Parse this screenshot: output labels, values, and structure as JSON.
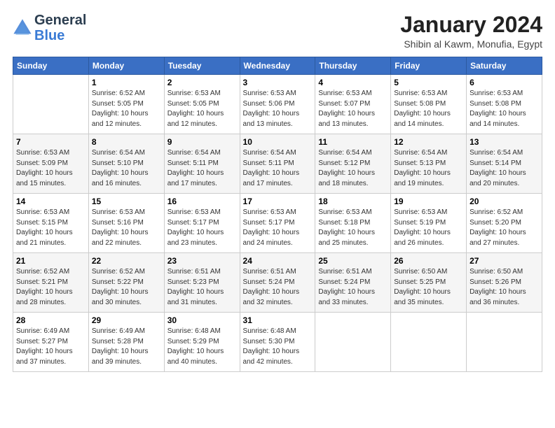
{
  "header": {
    "logo_line1": "General",
    "logo_line2": "Blue",
    "month_title": "January 2024",
    "location": "Shibin al Kawm, Monufia, Egypt"
  },
  "weekdays": [
    "Sunday",
    "Monday",
    "Tuesday",
    "Wednesday",
    "Thursday",
    "Friday",
    "Saturday"
  ],
  "weeks": [
    [
      {
        "day": "",
        "info": ""
      },
      {
        "day": "1",
        "info": "Sunrise: 6:52 AM\nSunset: 5:05 PM\nDaylight: 10 hours\nand 12 minutes."
      },
      {
        "day": "2",
        "info": "Sunrise: 6:53 AM\nSunset: 5:05 PM\nDaylight: 10 hours\nand 12 minutes."
      },
      {
        "day": "3",
        "info": "Sunrise: 6:53 AM\nSunset: 5:06 PM\nDaylight: 10 hours\nand 13 minutes."
      },
      {
        "day": "4",
        "info": "Sunrise: 6:53 AM\nSunset: 5:07 PM\nDaylight: 10 hours\nand 13 minutes."
      },
      {
        "day": "5",
        "info": "Sunrise: 6:53 AM\nSunset: 5:08 PM\nDaylight: 10 hours\nand 14 minutes."
      },
      {
        "day": "6",
        "info": "Sunrise: 6:53 AM\nSunset: 5:08 PM\nDaylight: 10 hours\nand 14 minutes."
      }
    ],
    [
      {
        "day": "7",
        "info": "Sunrise: 6:53 AM\nSunset: 5:09 PM\nDaylight: 10 hours\nand 15 minutes."
      },
      {
        "day": "8",
        "info": "Sunrise: 6:54 AM\nSunset: 5:10 PM\nDaylight: 10 hours\nand 16 minutes."
      },
      {
        "day": "9",
        "info": "Sunrise: 6:54 AM\nSunset: 5:11 PM\nDaylight: 10 hours\nand 17 minutes."
      },
      {
        "day": "10",
        "info": "Sunrise: 6:54 AM\nSunset: 5:11 PM\nDaylight: 10 hours\nand 17 minutes."
      },
      {
        "day": "11",
        "info": "Sunrise: 6:54 AM\nSunset: 5:12 PM\nDaylight: 10 hours\nand 18 minutes."
      },
      {
        "day": "12",
        "info": "Sunrise: 6:54 AM\nSunset: 5:13 PM\nDaylight: 10 hours\nand 19 minutes."
      },
      {
        "day": "13",
        "info": "Sunrise: 6:54 AM\nSunset: 5:14 PM\nDaylight: 10 hours\nand 20 minutes."
      }
    ],
    [
      {
        "day": "14",
        "info": "Sunrise: 6:53 AM\nSunset: 5:15 PM\nDaylight: 10 hours\nand 21 minutes."
      },
      {
        "day": "15",
        "info": "Sunrise: 6:53 AM\nSunset: 5:16 PM\nDaylight: 10 hours\nand 22 minutes."
      },
      {
        "day": "16",
        "info": "Sunrise: 6:53 AM\nSunset: 5:17 PM\nDaylight: 10 hours\nand 23 minutes."
      },
      {
        "day": "17",
        "info": "Sunrise: 6:53 AM\nSunset: 5:17 PM\nDaylight: 10 hours\nand 24 minutes."
      },
      {
        "day": "18",
        "info": "Sunrise: 6:53 AM\nSunset: 5:18 PM\nDaylight: 10 hours\nand 25 minutes."
      },
      {
        "day": "19",
        "info": "Sunrise: 6:53 AM\nSunset: 5:19 PM\nDaylight: 10 hours\nand 26 minutes."
      },
      {
        "day": "20",
        "info": "Sunrise: 6:52 AM\nSunset: 5:20 PM\nDaylight: 10 hours\nand 27 minutes."
      }
    ],
    [
      {
        "day": "21",
        "info": "Sunrise: 6:52 AM\nSunset: 5:21 PM\nDaylight: 10 hours\nand 28 minutes."
      },
      {
        "day": "22",
        "info": "Sunrise: 6:52 AM\nSunset: 5:22 PM\nDaylight: 10 hours\nand 30 minutes."
      },
      {
        "day": "23",
        "info": "Sunrise: 6:51 AM\nSunset: 5:23 PM\nDaylight: 10 hours\nand 31 minutes."
      },
      {
        "day": "24",
        "info": "Sunrise: 6:51 AM\nSunset: 5:24 PM\nDaylight: 10 hours\nand 32 minutes."
      },
      {
        "day": "25",
        "info": "Sunrise: 6:51 AM\nSunset: 5:24 PM\nDaylight: 10 hours\nand 33 minutes."
      },
      {
        "day": "26",
        "info": "Sunrise: 6:50 AM\nSunset: 5:25 PM\nDaylight: 10 hours\nand 35 minutes."
      },
      {
        "day": "27",
        "info": "Sunrise: 6:50 AM\nSunset: 5:26 PM\nDaylight: 10 hours\nand 36 minutes."
      }
    ],
    [
      {
        "day": "28",
        "info": "Sunrise: 6:49 AM\nSunset: 5:27 PM\nDaylight: 10 hours\nand 37 minutes."
      },
      {
        "day": "29",
        "info": "Sunrise: 6:49 AM\nSunset: 5:28 PM\nDaylight: 10 hours\nand 39 minutes."
      },
      {
        "day": "30",
        "info": "Sunrise: 6:48 AM\nSunset: 5:29 PM\nDaylight: 10 hours\nand 40 minutes."
      },
      {
        "day": "31",
        "info": "Sunrise: 6:48 AM\nSunset: 5:30 PM\nDaylight: 10 hours\nand 42 minutes."
      },
      {
        "day": "",
        "info": ""
      },
      {
        "day": "",
        "info": ""
      },
      {
        "day": "",
        "info": ""
      }
    ]
  ]
}
